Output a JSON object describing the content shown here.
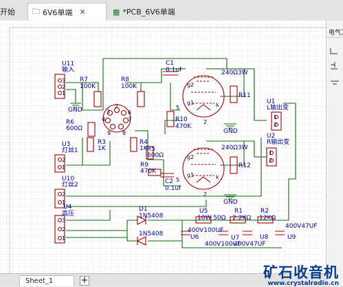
{
  "tabs": [
    {
      "label": "开始"
    },
    {
      "label": "6V6单端"
    },
    {
      "label": "*PCB_6V6单端"
    }
  ],
  "right_panel": {
    "label": "电气工"
  },
  "sheet": {
    "tab_label": "Sheet_1",
    "add_label": "+"
  },
  "watermark": {
    "title": "矿石收音机",
    "url": "www.crystalradio.cn"
  },
  "schematic": {
    "u11": {
      "name": "U11",
      "sub": "输入"
    },
    "r7": {
      "name": "R7",
      "value": "100K"
    },
    "r8": {
      "name": "R8",
      "value": "100K"
    },
    "c1": {
      "name": "C1",
      "value": "0.1uf"
    },
    "tube1_label": "240Ω3W",
    "tube2_label": "240Ω3W",
    "r11": {
      "name": "R11"
    },
    "r12": {
      "name": "R12"
    },
    "r10": {
      "name": "R10",
      "value": "470K"
    },
    "r9": {
      "name": "R9",
      "value": "470K"
    },
    "r6": {
      "name": "R6",
      "value": "600Ω"
    },
    "r5": {
      "name": "R5",
      "value": "600Ω"
    },
    "r3": {
      "name": "R3",
      "value": "1K"
    },
    "r4": {
      "name": "R4",
      "value": "1K"
    },
    "c2": {
      "name": "C2",
      "value": "0.1uf"
    },
    "u3": {
      "name": "U3",
      "sub": "灯丝1"
    },
    "u10": {
      "name": "U10",
      "sub": "灯丝2"
    },
    "u4": {
      "name": "U4",
      "sub": "高压"
    },
    "u1": {
      "name": "U1",
      "sub": "L输出变"
    },
    "u2": {
      "name": "U2",
      "sub": "R输出变"
    },
    "d1": {
      "name": "D1",
      "value": "1N5408"
    },
    "d2": {
      "value": "1N5408"
    },
    "u5": {
      "name": "U5",
      "value": "10W 50Ω"
    },
    "r1": {
      "name": "R1",
      "value": "2.2KΩ"
    },
    "r2": {
      "name": "R2",
      "value": "12KΩ"
    },
    "u6": {
      "name": "U6",
      "value": "400V100UF"
    },
    "u7": {
      "name": "U7",
      "value": "400V100UF"
    },
    "u8": {
      "name": "U8",
      "value": "400V47UF"
    },
    "u9": {
      "name": "U9",
      "value": "400V47UF"
    },
    "gnd": "GND",
    "pins": {
      "n1": "1",
      "n2": "2",
      "n3": "3",
      "n4": "4",
      "n5": "5",
      "n6": "6",
      "n7": "7",
      "n8": "8",
      "n9": "9"
    },
    "tube_pins": {
      "g1": "g1",
      "g2": "g2",
      "a": "a",
      "k": "k",
      "f": "f"
    }
  },
  "colors": {
    "wire": "#0b6b0b",
    "component": "#a00000",
    "text": "#0000aa",
    "canvas": "#ffffff",
    "grid": "#d8d8d8",
    "watermark": "#0a3d8f"
  }
}
